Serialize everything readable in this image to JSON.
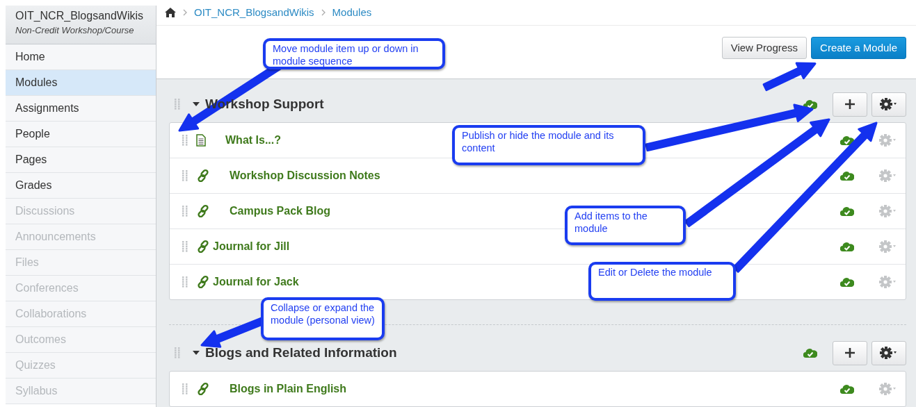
{
  "sidebar": {
    "course_title": "OIT_NCR_BlogsandWikis",
    "course_subtitle": "Non-Credit Workshop/Course",
    "items": [
      {
        "label": "Home",
        "selected": false,
        "disabled": false
      },
      {
        "label": "Modules",
        "selected": true,
        "disabled": false
      },
      {
        "label": "Assignments",
        "selected": false,
        "disabled": false
      },
      {
        "label": "People",
        "selected": false,
        "disabled": false
      },
      {
        "label": "Pages",
        "selected": false,
        "disabled": false
      },
      {
        "label": "Grades",
        "selected": false,
        "disabled": false
      },
      {
        "label": "Discussions",
        "selected": false,
        "disabled": true
      },
      {
        "label": "Announcements",
        "selected": false,
        "disabled": true
      },
      {
        "label": "Files",
        "selected": false,
        "disabled": true
      },
      {
        "label": "Conferences",
        "selected": false,
        "disabled": true
      },
      {
        "label": "Collaborations",
        "selected": false,
        "disabled": true
      },
      {
        "label": "Outcomes",
        "selected": false,
        "disabled": true
      },
      {
        "label": "Quizzes",
        "selected": false,
        "disabled": true
      },
      {
        "label": "Syllabus",
        "selected": false,
        "disabled": true
      }
    ]
  },
  "breadcrumb": [
    "OIT_NCR_BlogsandWikis",
    "Modules"
  ],
  "toolbar": {
    "buttons": [
      {
        "label": "View Progress",
        "kind": "default"
      },
      {
        "label": "Create a Module",
        "kind": "primary"
      }
    ]
  },
  "modules": [
    {
      "title": "Workshop Support",
      "expanded": true,
      "published": true,
      "items": [
        {
          "kind": "page",
          "title": "What Is...?",
          "indented": true,
          "published": true
        },
        {
          "kind": "link",
          "title": "Workshop Discussion Notes",
          "indented": true,
          "published": true
        },
        {
          "kind": "link",
          "title": "Campus Pack Blog",
          "indented": true,
          "published": true
        },
        {
          "kind": "link",
          "title": "Journal for Jill",
          "indented": false,
          "published": true
        },
        {
          "kind": "link",
          "title": "Journal for Jack",
          "indented": false,
          "published": true
        }
      ]
    },
    {
      "title": "Blogs and Related Information",
      "expanded": true,
      "published": true,
      "items": [
        {
          "kind": "link",
          "title": "Blogs in Plain English",
          "indented": true,
          "published": true
        }
      ]
    }
  ],
  "annotations": [
    {
      "text": "Move module item up or down in module sequence"
    },
    {
      "text": "Publish or hide the module and its content"
    },
    {
      "text": "Add items to the module"
    },
    {
      "text": "Edit or Delete the module"
    },
    {
      "text": "Collapse or expand the module (personal view)"
    }
  ]
}
